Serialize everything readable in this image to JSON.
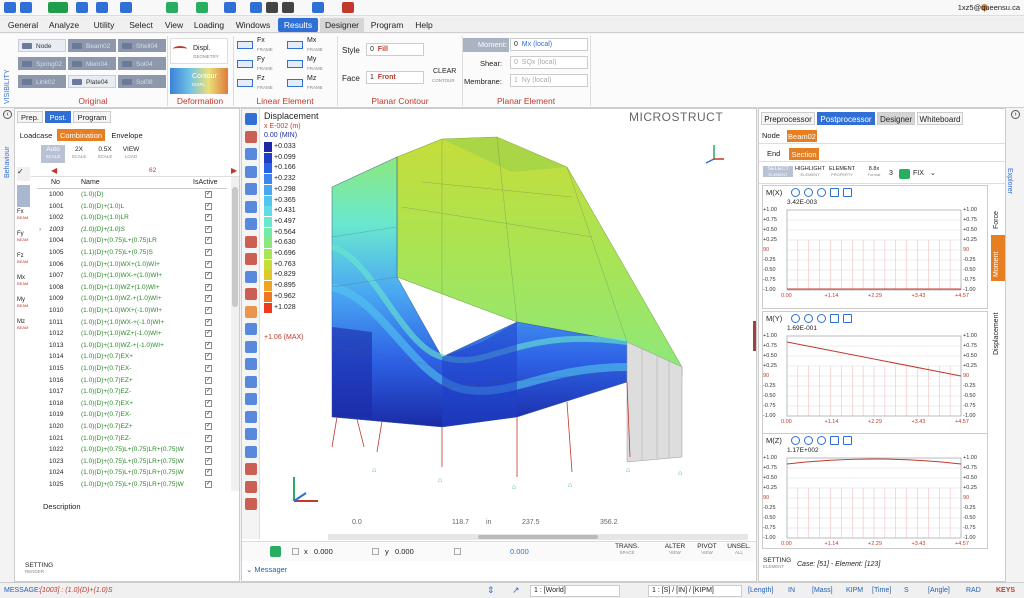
{
  "account": "1xz5@queensu.ca",
  "menu": [
    "General",
    "Analyze",
    "Utility",
    "Select",
    "View",
    "Loading",
    "Windows",
    "Results",
    "Designer",
    "Program",
    "Help"
  ],
  "active_menu": "Results",
  "ribbon": {
    "side_label": "VISIBILITY",
    "original": {
      "label": "Original",
      "items": [
        "Node",
        "Beam02",
        "Shell04",
        "Spring02",
        "Mem04",
        "Sol04",
        "Link02",
        "Plate04",
        "Sol08"
      ]
    },
    "deformation": {
      "label": "Deformation",
      "displ": "Displ.",
      "displ_sub": "GEOMETRY",
      "contour": "Contour",
      "contour_sub": "DISPL"
    },
    "linear": {
      "label": "Linear Element",
      "items": [
        "Fx",
        "Mx",
        "Fy",
        "My",
        "Fz",
        "Mz"
      ],
      "sub": "FRAME"
    },
    "planar_contour": {
      "label": "Planar Contour",
      "style_lbl": "Style",
      "style_num": "0",
      "style_val": "Fill",
      "face_lbl": "Face",
      "face_num": "1",
      "face_val": "Front",
      "clear": "CLEAR",
      "clear_sub": "CONTOUR"
    },
    "planar_element": {
      "label": "Planar Element",
      "moment": "Moment:",
      "moment_num": "0",
      "moment_val": "Mx (local)",
      "shear": "Shear:",
      "shear_num": "0",
      "shear_val": "SQx (local)",
      "membrane": "Membrane:",
      "membrane_num": "1",
      "membrane_val": "Ny (local)"
    }
  },
  "left": {
    "vtab": "Behaviour",
    "tabs": [
      "Prep.",
      "Post.",
      "Program"
    ],
    "subtabs": [
      "Loadcase",
      "Combination",
      "Envelope"
    ],
    "scale": [
      {
        "t": "Auto",
        "s": "SCALE"
      },
      {
        "t": "2X",
        "s": "SCALE"
      },
      {
        "t": "0.5X",
        "s": "SCALE"
      },
      {
        "t": "VIEW",
        "s": "LOAD"
      }
    ],
    "side": [
      {
        "t": "Fx",
        "s": "BEAM"
      },
      {
        "t": "Fy",
        "s": "BEAM"
      },
      {
        "t": "Fz",
        "s": "BEAM"
      },
      {
        "t": "Mx",
        "s": "BEAM"
      },
      {
        "t": "My",
        "s": "BEAM"
      },
      {
        "t": "Mz",
        "s": "BEAM"
      }
    ],
    "nav_num": "62",
    "head": [
      "No",
      "Name",
      "IsActive"
    ],
    "rows": [
      [
        "1000",
        "(1.0)(D)"
      ],
      [
        "1001",
        "(1.0)(D)+(1.0)L"
      ],
      [
        "1002",
        "(1.0)(D)+(1.0)LR"
      ],
      [
        "1003",
        "(1.0)(D)+(1.0)S"
      ],
      [
        "1004",
        "(1.0)(D)+(0.75)L+(0.75)LR"
      ],
      [
        "1005",
        "(1.1)(D)+(0.75)L+(0.75)S"
      ],
      [
        "1006",
        "(1.0)(D)+(1.0)WX+(1.0)WI+"
      ],
      [
        "1007",
        "(1.0)(D)+(1.0)WX-+(1.0)WI+"
      ],
      [
        "1008",
        "(1.0)(D)+(1.0)WZ+(1.0)WI+"
      ],
      [
        "1009",
        "(1.0)(D)+(1.0)WZ-+(1.0)WI+"
      ],
      [
        "1010",
        "(1.0)(D)+(1.0)WX+(-1.0)WI+"
      ],
      [
        "1011",
        "(1.0)(D)+(1.0)WX-+(-1.0)WI+"
      ],
      [
        "1012",
        "(1.0)(D)+(1.0)WZ+(-1.0)WI+"
      ],
      [
        "1013",
        "(1.0)(D)+(1.0)WZ-+(-1.0)WI+"
      ],
      [
        "1014",
        "(1.0)(D)+(0.7)EX+"
      ],
      [
        "1015",
        "(1.0)(D)+(0.7)EX-"
      ],
      [
        "1016",
        "(1.0)(D)+(0.7)EZ+"
      ],
      [
        "1017",
        "(1.0)(D)+(0.7)EZ-"
      ],
      [
        "1018",
        "(1.0)(D)+(0.7)EX+"
      ],
      [
        "1019",
        "(1.0)(D)+(0.7)EX-"
      ],
      [
        "1020",
        "(1.0)(D)+(0.7)EZ+"
      ],
      [
        "1021",
        "(1.0)(D)+(0.7)EZ-"
      ],
      [
        "1022",
        "(1.0)(D)+(0.75)L+(0.75)LR+(0.75)W"
      ],
      [
        "1023",
        "(1.0)(D)+(0.75)L+(0.75)LR+(0.75)W"
      ],
      [
        "1024",
        "(1.0)(D)+(0.75)L+(0.75)LR+(0.75)W"
      ],
      [
        "1025",
        "(1.0)(D)+(0.75)L+(0.75)LR+(0.75)W"
      ]
    ],
    "selected_row": "1003",
    "description": "Description",
    "setting": "SETTING",
    "setting_sub": "RENDER"
  },
  "viewport": {
    "title": "Displacement",
    "brand": "MICROSTRUCT",
    "legend_head1": "x E-002 (m)",
    "legend_head2": "0.00 (MIN)",
    "legend": [
      "+0.033",
      "+0.099",
      "+0.166",
      "+0.232",
      "+0.298",
      "+0.365",
      "+0.431",
      "+0.497",
      "+0.564",
      "+0.630",
      "+0.696",
      "+0.763",
      "+0.829",
      "+0.895",
      "+0.962",
      "+1.028"
    ],
    "legend_colors": [
      "#1a2aa6",
      "#1f3fc8",
      "#2e62e6",
      "#3d86ef",
      "#4aa8f2",
      "#54c6ee",
      "#5fdce6",
      "#69e8cf",
      "#74eaa6",
      "#8ce87e",
      "#a8e455",
      "#c6dd3a",
      "#dfc82a",
      "#efa523",
      "#f27722",
      "#ee3b1e"
    ],
    "legend_max": "+1.06 (MAX)",
    "ruler": [
      "0.0",
      "118.7",
      "in",
      "237.5",
      "356.2"
    ],
    "coord_x_lbl": "x",
    "coord_x": "0.000",
    "coord_y_lbl": "y",
    "coord_y": "0.000",
    "coord_z": "0.000",
    "bottom_btns": [
      {
        "t": "TRANS.",
        "s": "SPACE"
      },
      {
        "t": "ALTER",
        "s": "VIEW"
      },
      {
        "t": "PIVOT",
        "s": "VIEW"
      },
      {
        "t": "UNSEL.",
        "s": "ALL"
      }
    ],
    "messager": "Messager"
  },
  "right": {
    "vtab": "Explorer",
    "tabs": [
      "Preprocessor",
      "Postprocessor",
      "Designer",
      "Whiteboard"
    ],
    "node": "Node",
    "beam": "Beam02",
    "end": "End",
    "section": "Section",
    "tools": [
      {
        "t": "SELECT",
        "s": "ELEMENT"
      },
      {
        "t": "HIGHLIGHT",
        "s": "ELEMENT"
      },
      {
        "t": "ELEMENT",
        "s": "PROPERTY"
      },
      {
        "t": "8.8x",
        "s": "Format"
      }
    ],
    "fix_num": "3",
    "fix": "FIX",
    "side_tabs": [
      "Force",
      "Moment",
      "Displacement"
    ],
    "charts": [
      {
        "name": "M(X)",
        "val": "3.42E-003"
      },
      {
        "name": "M(Y)",
        "val": "1.69E-001"
      },
      {
        "name": "M(Z)",
        "val": "1.17E+002"
      }
    ],
    "yticks": [
      "+1.00",
      "+0.75",
      "+0.50",
      "+0.25",
      "90",
      "-0.25",
      "-0.50",
      "-0.75",
      "-1.00"
    ],
    "xticks": [
      "0.00",
      "+1.14",
      "+2.29",
      "+3.43",
      "+4.57"
    ],
    "setting": "SETTING",
    "setting_sub": "ELEMENT",
    "case": "Case: [51] - Element: [123]"
  },
  "status": {
    "message_lbl": "MESSAGE:",
    "message": "[1003] : (1.0)(D)+(1.0)S",
    "world": "1 : [World]",
    "units": "1 : [S] / [IN] / [KIPM]",
    "items": [
      "[Length]",
      "IN",
      "[Mass]",
      "KIPM",
      "[Time]",
      "S",
      "[Angle]",
      "RAD",
      "KEYS"
    ]
  },
  "colors": {
    "accent": "#2f6fd6",
    "orange": "#e67e22",
    "red": "#c0392b"
  }
}
